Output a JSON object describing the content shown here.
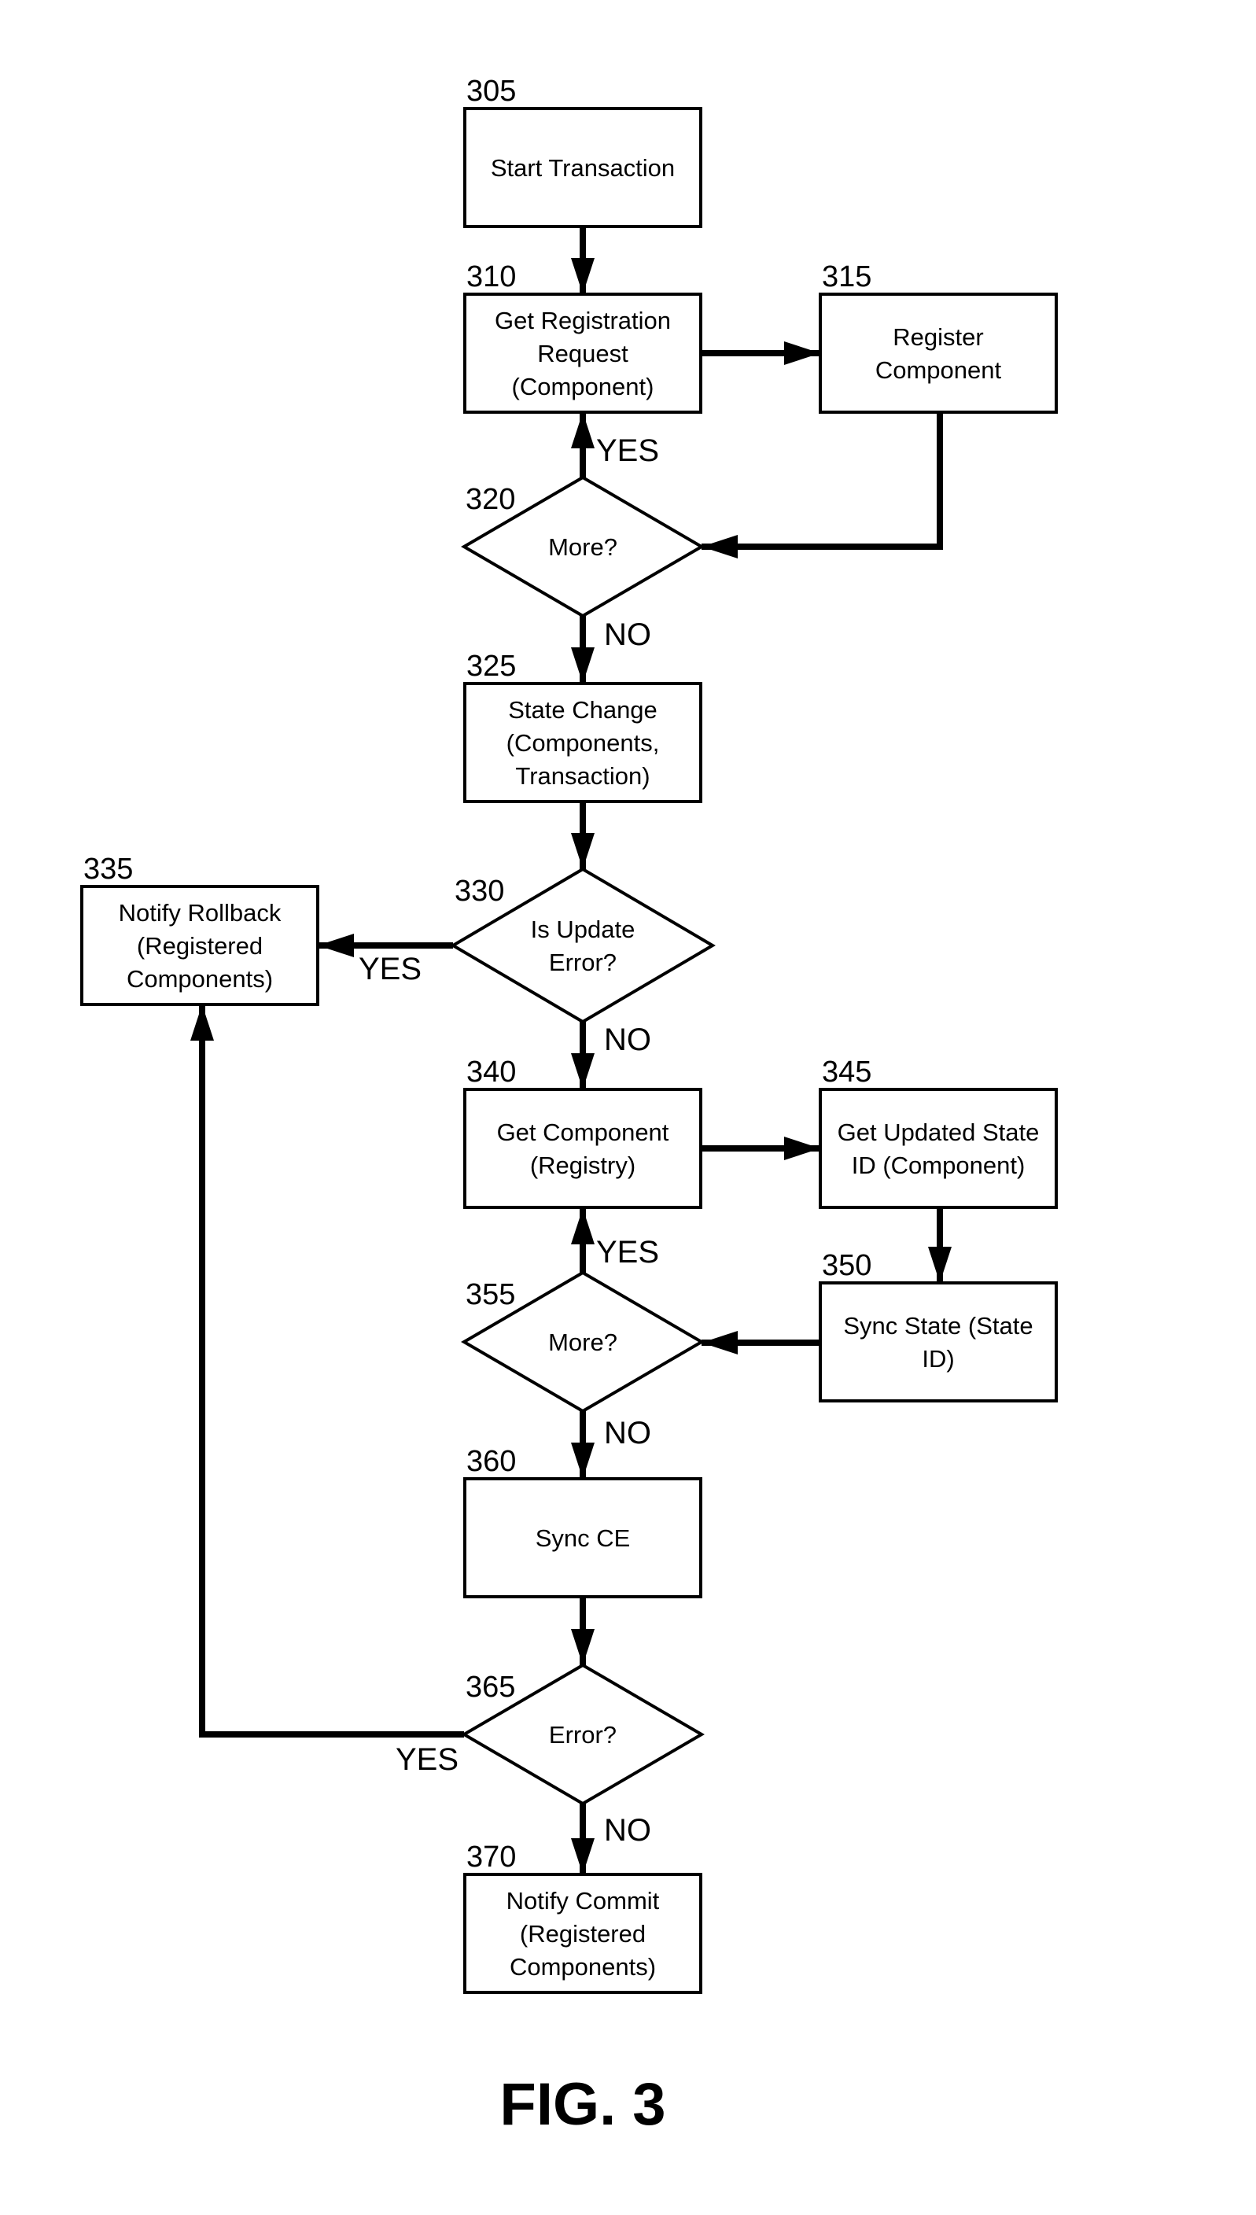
{
  "figure": {
    "caption": "FIG. 3",
    "nodes": [
      {
        "id": "305",
        "type": "process",
        "lines": [
          "Start Transaction"
        ]
      },
      {
        "id": "310",
        "type": "process",
        "lines": [
          "Get Registration",
          "Request",
          "(Component)"
        ]
      },
      {
        "id": "315",
        "type": "process",
        "lines": [
          "Register",
          "Component"
        ]
      },
      {
        "id": "320",
        "type": "decision",
        "lines": [
          "More?"
        ]
      },
      {
        "id": "325",
        "type": "process",
        "lines": [
          "State Change",
          "(Components,",
          "Transaction)"
        ]
      },
      {
        "id": "330",
        "type": "decision",
        "lines": [
          "Is Update",
          "Error?"
        ]
      },
      {
        "id": "335",
        "type": "process",
        "lines": [
          "Notify Rollback",
          "(Registered",
          "Components)"
        ]
      },
      {
        "id": "340",
        "type": "process",
        "lines": [
          "Get Component",
          "(Registry)"
        ]
      },
      {
        "id": "345",
        "type": "process",
        "lines": [
          "Get Updated State",
          "ID (Component)"
        ]
      },
      {
        "id": "350",
        "type": "process",
        "lines": [
          "Sync State (State",
          "ID)"
        ]
      },
      {
        "id": "355",
        "type": "decision",
        "lines": [
          "More?"
        ]
      },
      {
        "id": "360",
        "type": "process",
        "lines": [
          "Sync CE"
        ]
      },
      {
        "id": "365",
        "type": "decision",
        "lines": [
          "Error?"
        ]
      },
      {
        "id": "370",
        "type": "process",
        "lines": [
          "Notify Commit",
          "(Registered",
          "Components)"
        ]
      }
    ],
    "edges": [
      {
        "from": "305",
        "to": "310",
        "label": ""
      },
      {
        "from": "310",
        "to": "315",
        "label": ""
      },
      {
        "from": "315",
        "to": "320",
        "label": ""
      },
      {
        "from": "320",
        "to": "310",
        "label": "YES"
      },
      {
        "from": "320",
        "to": "325",
        "label": "NO"
      },
      {
        "from": "325",
        "to": "330",
        "label": ""
      },
      {
        "from": "330",
        "to": "335",
        "label": "YES"
      },
      {
        "from": "330",
        "to": "340",
        "label": "NO"
      },
      {
        "from": "340",
        "to": "345",
        "label": ""
      },
      {
        "from": "345",
        "to": "350",
        "label": ""
      },
      {
        "from": "350",
        "to": "355",
        "label": ""
      },
      {
        "from": "355",
        "to": "340",
        "label": "YES"
      },
      {
        "from": "355",
        "to": "360",
        "label": "NO"
      },
      {
        "from": "360",
        "to": "365",
        "label": ""
      },
      {
        "from": "365",
        "to": "335",
        "label": "YES"
      },
      {
        "from": "365",
        "to": "370",
        "label": "NO"
      }
    ]
  }
}
